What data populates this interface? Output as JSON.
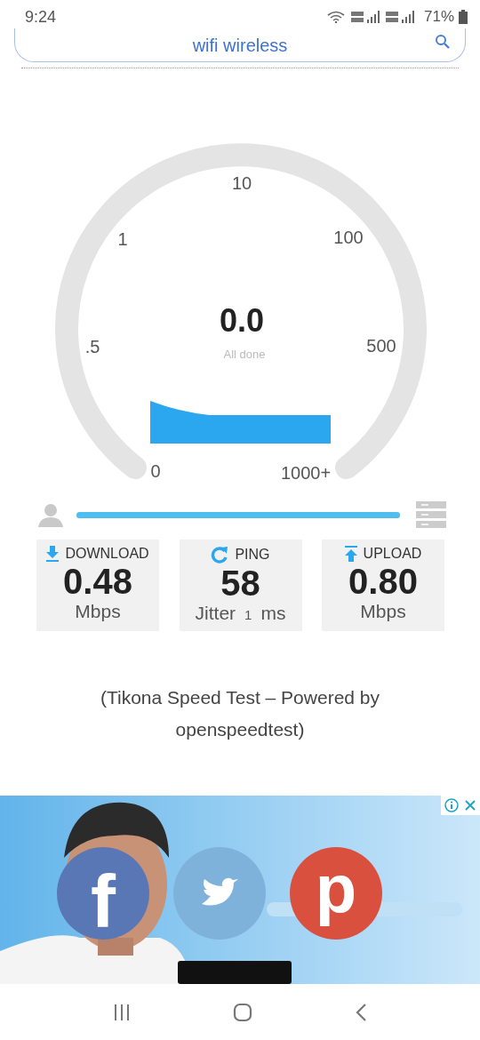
{
  "status_bar": {
    "time": "9:24",
    "battery": "71%"
  },
  "search": {
    "value": "wifi wireless"
  },
  "gauge": {
    "value": "0.0",
    "status": "All done",
    "labels": [
      "0",
      ".5",
      "1",
      "10",
      "100",
      "500",
      "1000+"
    ]
  },
  "progress": {
    "level": 1
  },
  "stats": [
    {
      "kind": "download",
      "label": "DOWNLOAD",
      "value": "0.48",
      "unit": "Mbps"
    },
    {
      "kind": "ping",
      "label": "PING",
      "value": "58",
      "jitter_label": "Jitter",
      "jitter": "1",
      "unit": "ms"
    },
    {
      "kind": "upload",
      "label": "UPLOAD",
      "value": "0.80",
      "unit": "Mbps"
    }
  ],
  "credits": "(Tikona Speed Test – Powered by openspeedtest)",
  "share": [
    {
      "kind": "facebook",
      "glyph": "f",
      "color": "#5a77b5"
    },
    {
      "kind": "twitter",
      "color": "#7fb2db"
    },
    {
      "kind": "pinterest",
      "glyph": "p",
      "color": "#d9503f"
    }
  ]
}
